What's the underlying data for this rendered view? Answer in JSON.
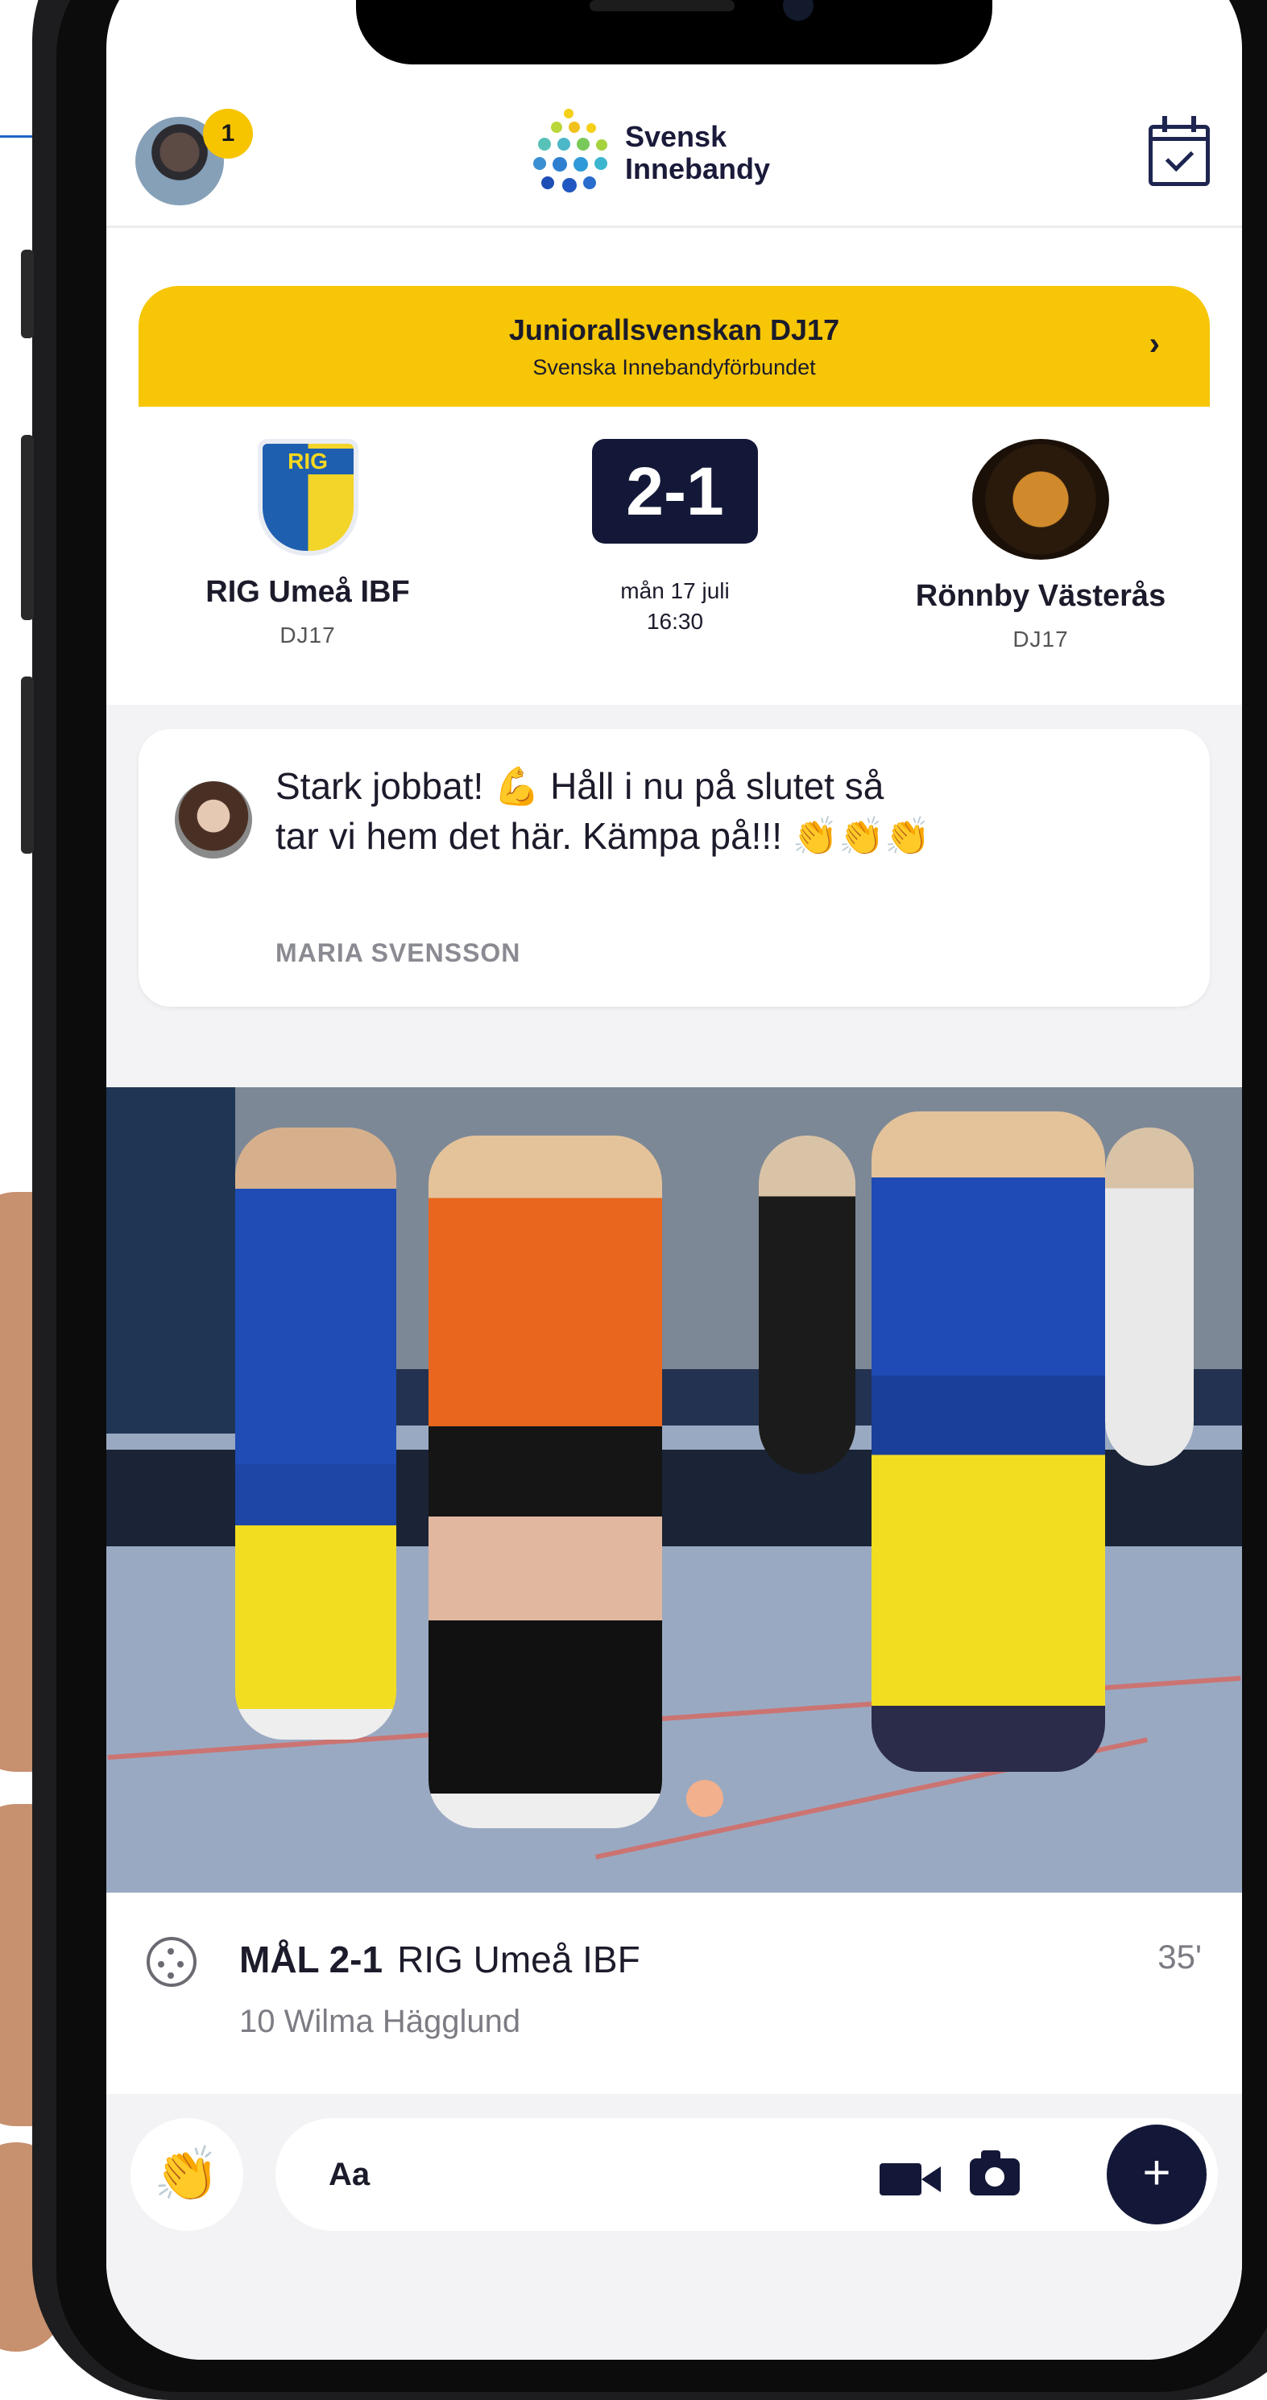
{
  "header": {
    "notification_count": "1",
    "logo_line1": "Svensk",
    "logo_line2": "Innebandy"
  },
  "league": {
    "title": "Juniorallsvenskan DJ17",
    "subtitle": "Svenska Innebandyförbundet",
    "arrow": "›"
  },
  "match": {
    "home": {
      "name": "RIG Umeå IBF",
      "division": "DJ17",
      "crest_text": "RIG"
    },
    "away": {
      "name": "Rönnby Västerås",
      "division": "DJ17"
    },
    "score": "2-1",
    "date": "mån 17 juli",
    "time": "16:30"
  },
  "comment": {
    "text_line1": "Stark jobbat! 💪  Håll i nu på slutet så",
    "text_line2": "tar vi hem det här. Kämpa på!!! 👏👏👏",
    "author": "MARIA SVENSSON"
  },
  "event": {
    "type": "MÅL 2-1",
    "team": "RIG Umeå IBF",
    "player": "10 Wilma Hägglund",
    "minute": "35'"
  },
  "input": {
    "clap_emoji": "👏",
    "placeholder": "Aa",
    "plus": "+"
  },
  "colors": {
    "accent_yellow": "#f6c607",
    "navy": "#141838",
    "background_grey": "#f3f3f5"
  },
  "icons": [
    "calendar-check-icon",
    "video-camera-icon",
    "camera-icon",
    "plus-icon",
    "floorball-icon",
    "chevron-right-icon"
  ]
}
